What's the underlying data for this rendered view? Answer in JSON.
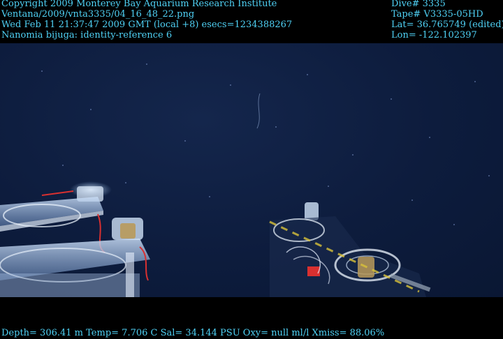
{
  "overlay": {
    "top_left": [
      "Copyright 2009 Monterey Bay Aquarium Research Institute",
      "Ventana/2009/vnta3335/04_16_48_22.png",
      "Wed Feb 11 21:37:47 2009 GMT (local +8)  esecs=1234388267",
      "Nanomia bijuga: identity-reference 6"
    ],
    "top_right": [
      "Dive# 3335",
      "Tape# V3335-05HD",
      "Lat= 36.765749 (edited)",
      "Lon= -122.102397"
    ],
    "bottom": "Depth= 306.41 m  Temp= 7.706 C  Sal= 34.144 PSU  Oxy= null ml/l  Xmiss= 88.06%"
  },
  "colors": {
    "overlay_text": "#4fd1f5",
    "water": "#0d1c3d",
    "letterbox": "#000000"
  }
}
